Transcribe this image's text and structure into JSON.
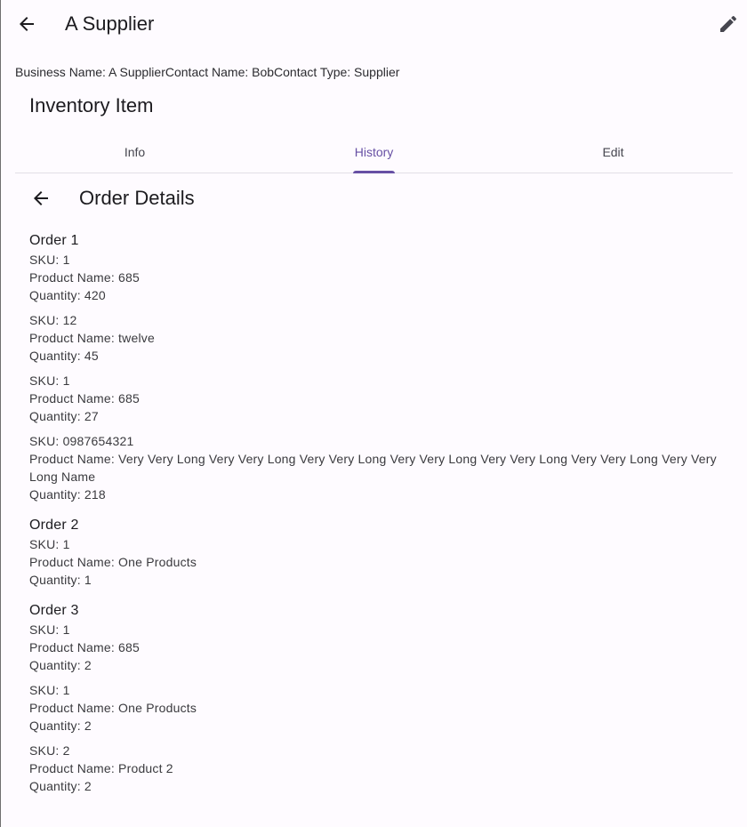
{
  "appbar": {
    "title": "A Supplier",
    "back_icon": "arrow-left-icon",
    "edit_icon": "pencil-icon"
  },
  "summary": "Business Name: A SupplierContact Name: BobContact Type: Supplier",
  "section_title": "Inventory Item",
  "tabs": [
    {
      "label": "Info"
    },
    {
      "label": "History"
    },
    {
      "label": "Edit"
    }
  ],
  "active_tab": "History",
  "details": {
    "title": "Order Details"
  },
  "orders": [
    {
      "title": "Order 1",
      "items": [
        {
          "sku": "SKU: 1",
          "name": "Product Name: 685",
          "qty": "Quantity: 420"
        },
        {
          "sku": "SKU: 12",
          "name": "Product Name: twelve",
          "qty": "Quantity: 45"
        },
        {
          "sku": "SKU: 1",
          "name": "Product Name: 685",
          "qty": "Quantity: 27"
        },
        {
          "sku": "SKU: 0987654321",
          "name": "Product Name: Very Very Long Very Very Long Very Very Long Very Very Long Very Very Long Very Very Long Very Very Long Name",
          "qty": "Quantity: 218"
        }
      ]
    },
    {
      "title": "Order 2",
      "items": [
        {
          "sku": "SKU: 1",
          "name": "Product Name: One Products",
          "qty": "Quantity: 1"
        }
      ]
    },
    {
      "title": "Order 3",
      "items": [
        {
          "sku": "SKU: 1",
          "name": "Product Name: 685",
          "qty": "Quantity: 2"
        },
        {
          "sku": "SKU: 1",
          "name": "Product Name: One Products",
          "qty": "Quantity: 2"
        },
        {
          "sku": "SKU: 2",
          "name": "Product Name: Product 2",
          "qty": "Quantity: 2"
        }
      ]
    }
  ],
  "colors": {
    "accent": "#6750a4",
    "background": "#fefbff",
    "text": "#1c1b1f"
  }
}
